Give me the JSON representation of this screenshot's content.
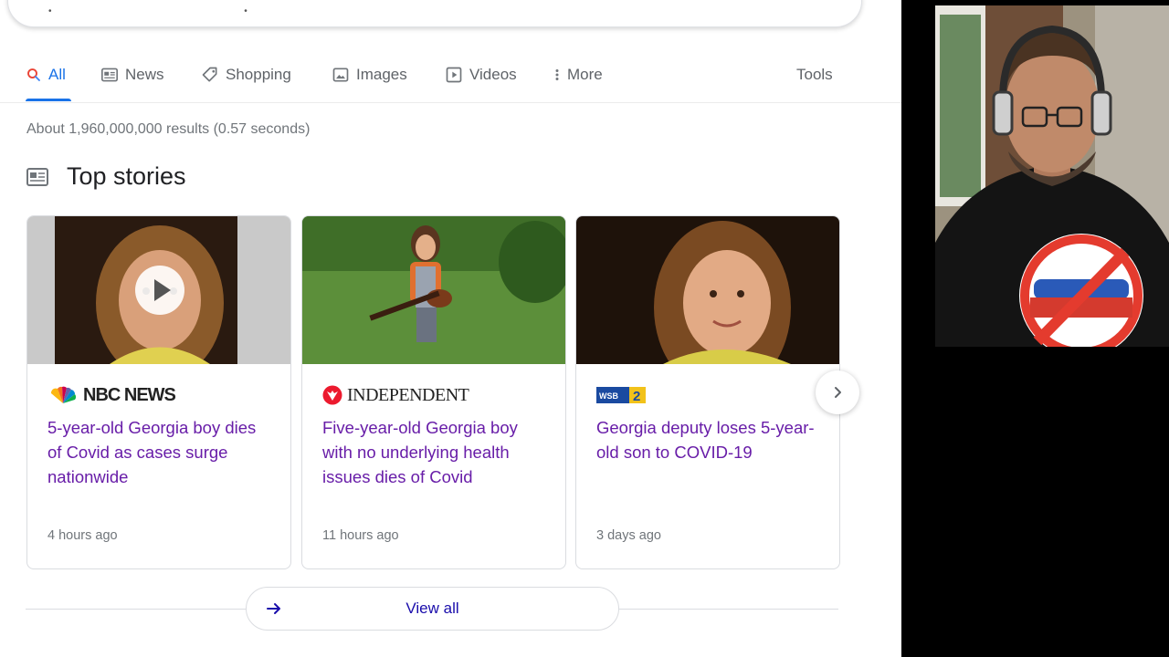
{
  "tabs": [
    {
      "label": "All",
      "icon": "search-icon",
      "active": true
    },
    {
      "label": "News",
      "icon": "news-icon"
    },
    {
      "label": "Shopping",
      "icon": "tag-icon"
    },
    {
      "label": "Images",
      "icon": "image-icon"
    },
    {
      "label": "Videos",
      "icon": "play-box-icon"
    },
    {
      "label": "More",
      "icon": "more-vert-icon"
    }
  ],
  "tools_label": "Tools",
  "result_stats": "About 1,960,000,000 results (0.57 seconds)",
  "top_stories": {
    "title": "Top stories",
    "cards": [
      {
        "source": "NBC NEWS",
        "headline": "5-year-old Georgia boy dies of Covid as cases surge nationwide",
        "time": "4 hours ago",
        "has_video": true
      },
      {
        "source": "INDEPENDENT",
        "headline": "Five-year-old Georgia boy with no underlying health issues dies of Covid",
        "time": "11 hours ago"
      },
      {
        "source": "WSB-TV 2",
        "headline": "Georgia deputy loses 5-year-old son to COVID-19",
        "time": "3 days ago"
      }
    ]
  },
  "view_all_label": "View all",
  "colors": {
    "accent": "#1a73e8",
    "visited_link": "#681da8",
    "meta_text": "#70757a"
  }
}
